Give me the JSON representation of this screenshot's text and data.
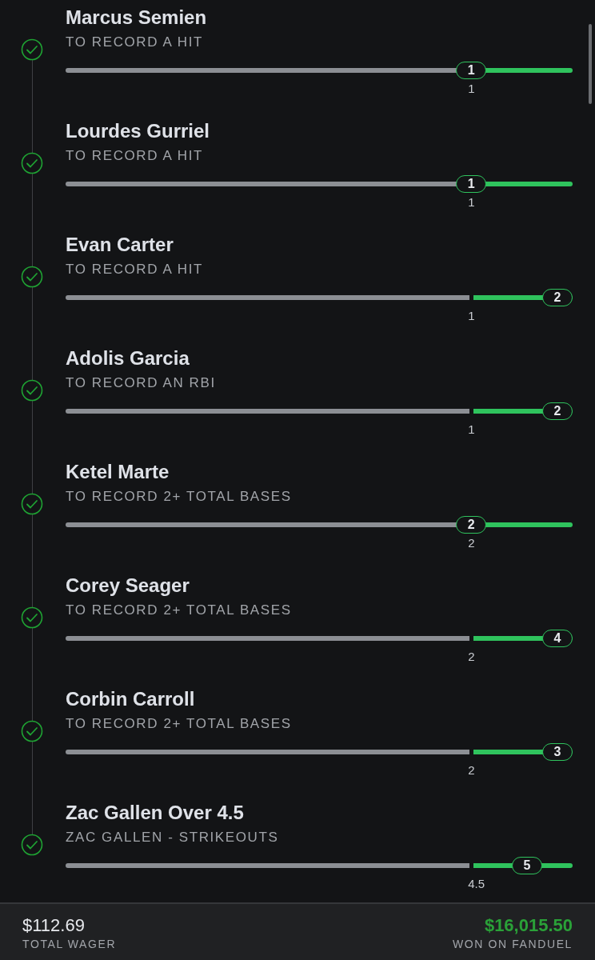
{
  "legs": [
    {
      "player": "Marcus Semien",
      "market": "TO RECORD A HIT",
      "won": true,
      "line": "1",
      "result": "1",
      "level": 0.8
    },
    {
      "player": "Lourdes Gurriel",
      "market": "TO RECORD A HIT",
      "won": true,
      "line": "1",
      "result": "1",
      "level": 0.8
    },
    {
      "player": "Evan Carter",
      "market": "TO RECORD A HIT",
      "won": true,
      "line": "1",
      "result": "2",
      "level": 0.97
    },
    {
      "player": "Adolis Garcia",
      "market": "TO RECORD AN RBI",
      "won": true,
      "line": "1",
      "result": "2",
      "level": 0.97
    },
    {
      "player": "Ketel Marte",
      "market": "TO RECORD 2+ TOTAL BASES",
      "won": true,
      "line": "2",
      "result": "2",
      "level": 0.8
    },
    {
      "player": "Corey Seager",
      "market": "TO RECORD 2+ TOTAL BASES",
      "won": true,
      "line": "2",
      "result": "4",
      "level": 0.97
    },
    {
      "player": "Corbin Carroll",
      "market": "TO RECORD 2+ TOTAL BASES",
      "won": true,
      "line": "2",
      "result": "3",
      "level": 0.97
    },
    {
      "player": "Zac Gallen Over 4.5",
      "market": "ZAC GALLEN - STRIKEOUTS",
      "won": true,
      "line": "4.5",
      "result": "5",
      "level": 0.91
    }
  ],
  "footer": {
    "wager": "$112.69",
    "wager_label": "TOTAL WAGER",
    "payout": "$16,015.50",
    "payout_label": "WON ON FANDUEL"
  }
}
